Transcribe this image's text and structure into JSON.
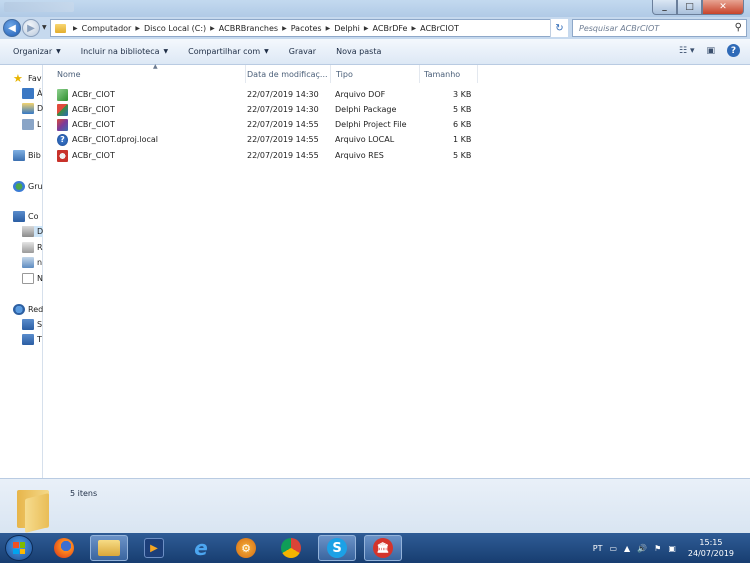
{
  "window": {
    "minimize_glyph": "_",
    "maximize_glyph": "□",
    "close_glyph": "✕"
  },
  "address": {
    "back_glyph": "◀",
    "forward_glyph": "▶",
    "crumbs": [
      "Computador",
      "Disco Local (C:)",
      "ACBRBranches",
      "Pacotes",
      "Delphi",
      "ACBrDFe",
      "ACBrCIOT"
    ],
    "search_placeholder": "Pesquisar ACBrCIOT",
    "refresh_glyph": "↻"
  },
  "toolbar": {
    "organize": "Organizar",
    "include_library": "Incluir na biblioteca",
    "share": "Compartilhar com",
    "burn": "Gravar",
    "new_folder": "Nova pasta"
  },
  "nav": {
    "items": [
      {
        "label": "Fav",
        "icon": "star-icon"
      },
      {
        "label": "Á",
        "icon": "desktop-icon"
      },
      {
        "label": "D",
        "icon": "downloads-icon"
      },
      {
        "label": "L",
        "icon": "recent-places-icon"
      },
      {
        "label": "Bib",
        "icon": "libraries-icon"
      },
      {
        "label": "Gru",
        "icon": "homegroup-icon"
      },
      {
        "label": "Co",
        "icon": "computer-icon"
      },
      {
        "label": "D",
        "icon": "local-disk-icon"
      },
      {
        "label": "R",
        "icon": "drive-icon"
      },
      {
        "label": "n",
        "icon": "network-drive-icon"
      },
      {
        "label": "N",
        "icon": "blank-drive-icon"
      },
      {
        "label": "Red",
        "icon": "network-icon"
      },
      {
        "label": "S",
        "icon": "network-computer-icon"
      },
      {
        "label": "T",
        "icon": "network-computer-icon"
      }
    ]
  },
  "columns": {
    "name": "Nome",
    "date": "Data de modificaç...",
    "type": "Tipo",
    "size": "Tamanho"
  },
  "files": [
    {
      "name": "ACBr_CIOT",
      "date": "22/07/2019 14:30",
      "type": "Arquivo DOF",
      "size": "3 KB",
      "icon": "dof-file-icon"
    },
    {
      "name": "ACBr_CIOT",
      "date": "22/07/2019 14:30",
      "type": "Delphi Package",
      "size": "5 KB",
      "icon": "delphi-package-icon"
    },
    {
      "name": "ACBr_CIOT",
      "date": "22/07/2019 14:55",
      "type": "Delphi Project File",
      "size": "6 KB",
      "icon": "delphi-project-icon"
    },
    {
      "name": "ACBr_CIOT.dproj.local",
      "date": "22/07/2019 14:55",
      "type": "Arquivo LOCAL",
      "size": "1 KB",
      "icon": "unknown-file-icon"
    },
    {
      "name": "ACBr_CIOT",
      "date": "22/07/2019 14:55",
      "type": "Arquivo RES",
      "size": "5 KB",
      "icon": "res-file-icon"
    }
  ],
  "details": {
    "count": "5 itens"
  },
  "taskbar": {
    "language": "PT",
    "time": "15:15",
    "date": "24/07/2019",
    "apps": [
      {
        "name": "firefox",
        "glyph": ""
      },
      {
        "name": "file-explorer",
        "glyph": ""
      },
      {
        "name": "media-player",
        "glyph": "▶"
      },
      {
        "name": "internet-explorer",
        "glyph": "e"
      },
      {
        "name": "settings-app",
        "glyph": "⚙"
      },
      {
        "name": "chrome",
        "glyph": ""
      },
      {
        "name": "skype",
        "glyph": "S"
      },
      {
        "name": "bank-app",
        "glyph": "🏛"
      }
    ]
  },
  "colors": {
    "accent": "#2f6ab7",
    "taskbar": "#1f4a82",
    "folder": "#e9bd56"
  }
}
